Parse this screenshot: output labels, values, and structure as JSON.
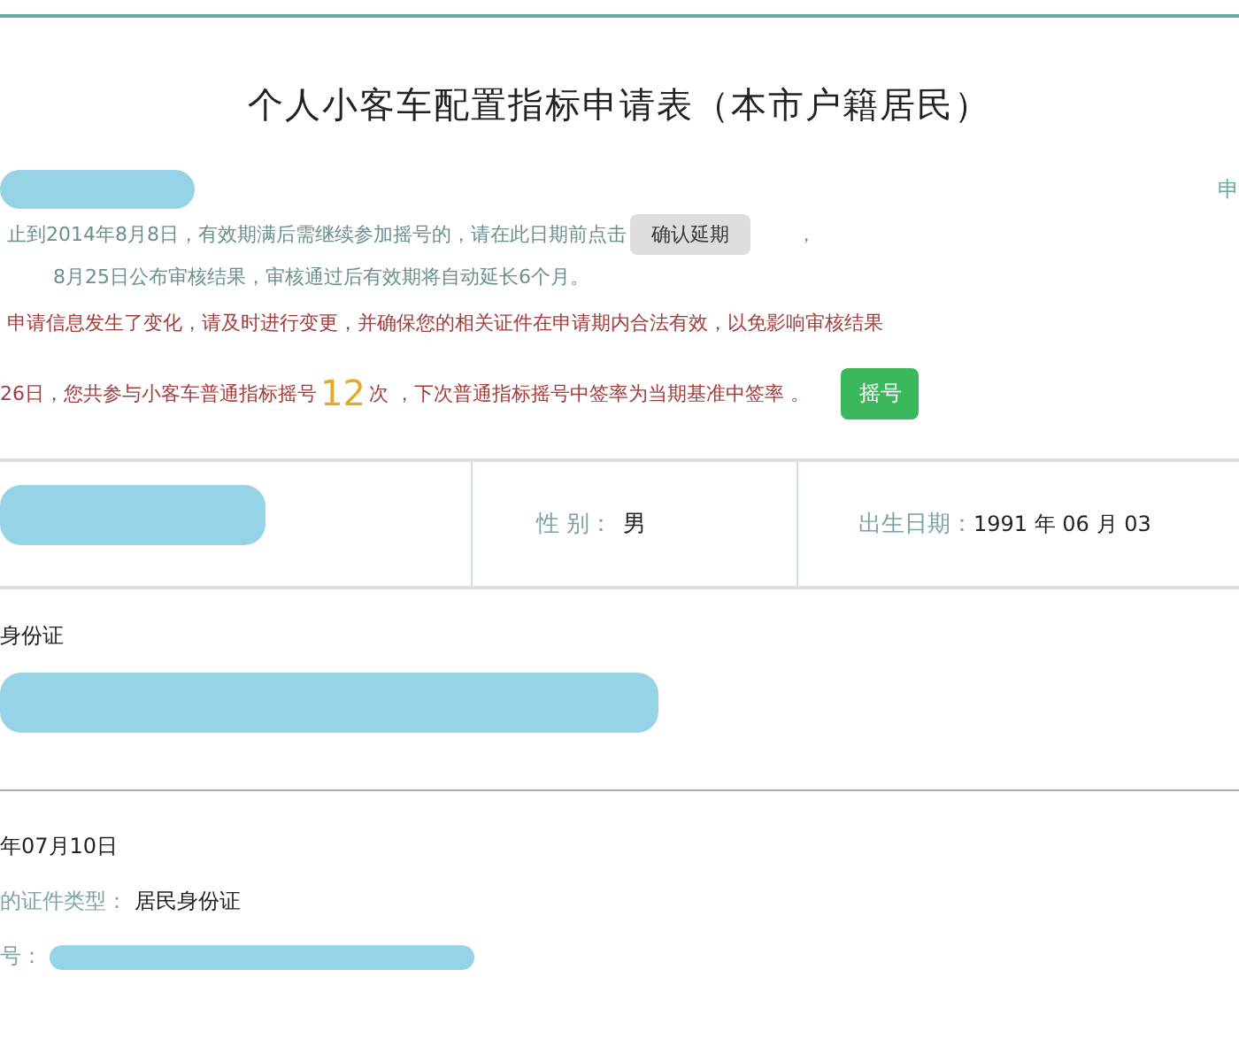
{
  "title": "个人小客车配置指标申请表（本市户籍居民）",
  "top_right_text": "申",
  "notices": [
    {
      "kind": "info",
      "text": "止到2014年8月8日，有效期满后需继续参加摇号的，请在此日期前点击",
      "button": "确认延期",
      "after": "，"
    },
    {
      "kind": "info",
      "text": "8月25日公布审核结果，审核通过后有效期将自动延长6个月。"
    },
    {
      "kind": "warning",
      "text": "申请信息发生了变化，请及时进行变更，并确保您的相关证件在申请期内合法有效，以免影响审核结果"
    },
    {
      "kind": "count",
      "before": "26日，您共参与小客车普通指标摇号",
      "count": "12",
      "after": "次 ，下次普通指标摇号中签率为当期基准中签率 。",
      "button": "摇号"
    }
  ],
  "info_row": {
    "gender_label": "性 别：",
    "gender": "男",
    "birth_label": "出生日期：",
    "birth": "1991 年 06 月 03"
  },
  "id_type_text": "身份证",
  "details": [
    {
      "kind": "plain",
      "text": "年07月10日"
    },
    {
      "kind": "pair",
      "label": "的证件类型：",
      "value": "居民身份证"
    },
    {
      "kind": "redacted",
      "label": "号："
    }
  ]
}
